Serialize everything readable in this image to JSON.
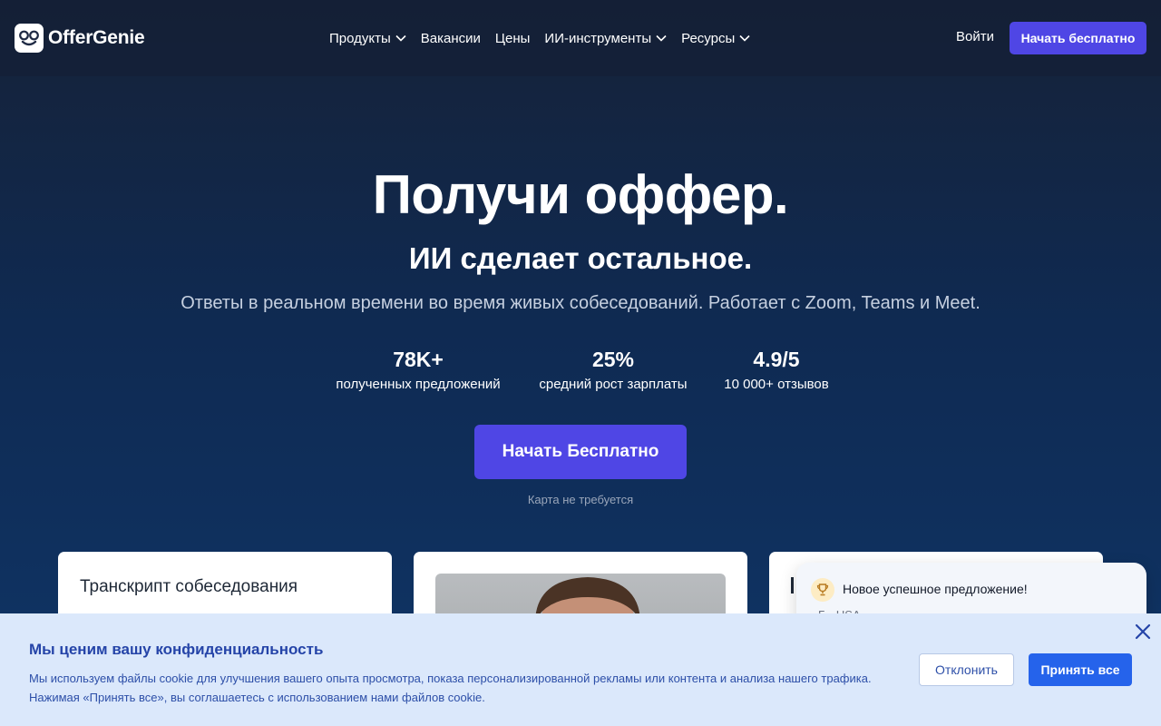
{
  "nav": {
    "brand": "OfferGenie",
    "menu": [
      {
        "label": "Продукты",
        "dropdown": true
      },
      {
        "label": "Вакансии",
        "dropdown": false
      },
      {
        "label": "Цены",
        "dropdown": false
      },
      {
        "label": "ИИ-инструменты",
        "dropdown": true
      },
      {
        "label": "Ресурсы",
        "dropdown": true
      }
    ],
    "login": "Войти",
    "cta": "Начать бесплатно"
  },
  "hero": {
    "title": "Получи оффер.",
    "subtitle": "ИИ сделает остальное.",
    "description": "Ответы в реальном времени во время живых собеседований. Работает с Zoom, Teams и Meet.",
    "stats": [
      {
        "value": "78K+",
        "label": "полученных предложений"
      },
      {
        "value": "25%",
        "label": "средний рост зарплаты"
      },
      {
        "value": "4.9/5",
        "label": "10 000+ отзывов"
      }
    ],
    "cta": "Начать Бесплатно",
    "note": "Карта не требуется"
  },
  "cards": {
    "transcript_title": "Транскрипт собеседования"
  },
  "toast": {
    "title": "Новое успешное предложение!",
    "subtitle": "Г... USA"
  },
  "cookie": {
    "title": "Мы ценим вашу конфиденциальность",
    "text": "Мы используем файлы cookie для улучшения вашего опыта просмотра, показа персонализированной рекламы или контента и анализа нашего трафика. Нажимая «Принять все», вы соглашаетесь с использованием нами файлов cookie.",
    "decline": "Отклонить",
    "accept": "Принять все"
  },
  "colors": {
    "accent": "#4f46e5",
    "cookie_bg": "#dbe8fb",
    "cookie_accent": "#2563eb"
  }
}
